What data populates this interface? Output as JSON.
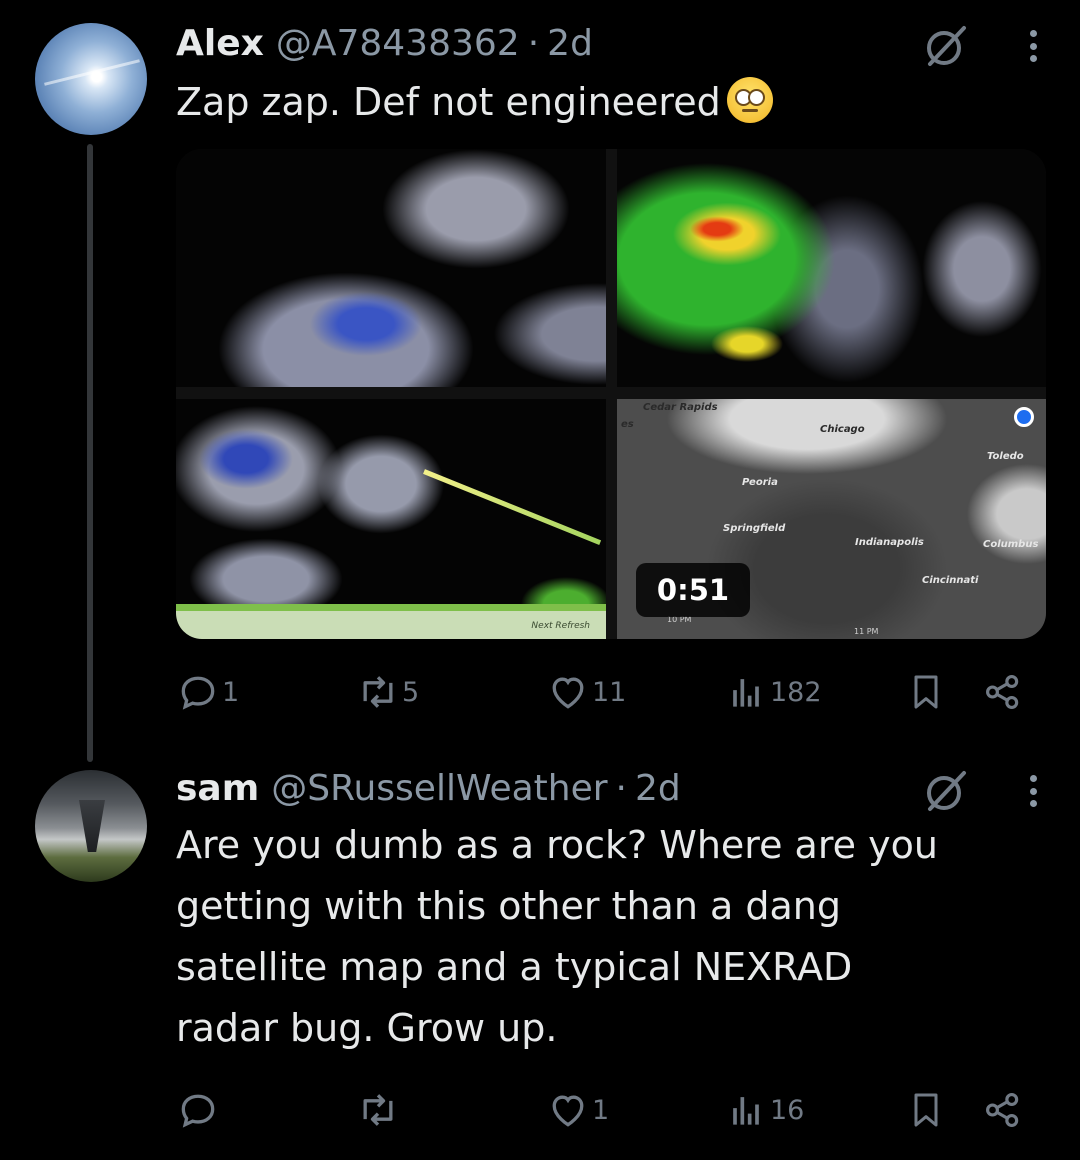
{
  "posts": [
    {
      "name": "Alex",
      "handle": "@A78438362",
      "separator": "·",
      "time": "2d",
      "text": "Zap zap. Def not engineered",
      "emoji": "face-with-rolling-eyes",
      "media": {
        "video_duration": "0:51",
        "map_labels": [
          "Cedar Rapids",
          "Chicago",
          "Toledo",
          "Peoria",
          "Springfield",
          "Indianapolis",
          "Columbus",
          "Cincinnati"
        ],
        "time_labels": [
          "10 PM",
          "11 PM"
        ],
        "radar_caption": "Next Refresh",
        "edge_label": "es"
      },
      "actions": {
        "replies": "1",
        "reposts": "5",
        "likes": "11",
        "views": "182"
      }
    },
    {
      "name": "sam",
      "handle": "@SRussellWeather",
      "separator": "·",
      "time": "2d",
      "text_lines": [
        "Are you dumb as a rock? Where are you",
        "getting with this other than a dang",
        "satellite map and a typical NEXRAD",
        "radar bug. Grow up."
      ],
      "actions": {
        "replies": "",
        "reposts": "",
        "likes": "1",
        "views": "16"
      }
    }
  ],
  "colors": {
    "background": "#000000",
    "text": "#e7e9ea",
    "muted": "#8b98a5",
    "thread_line": "#333639",
    "action": "#717a85"
  }
}
